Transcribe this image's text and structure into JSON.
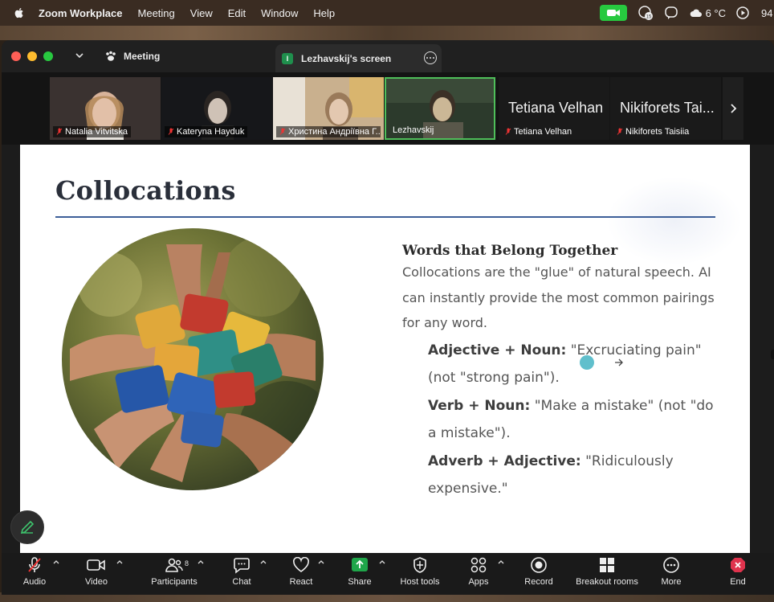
{
  "menubar": {
    "app": "Zoom Workplace",
    "items": [
      "Meeting",
      "View",
      "Edit",
      "Window",
      "Help"
    ],
    "badge_count": "15",
    "weather": "6 °C",
    "battery": "94"
  },
  "window": {
    "meeting_tab": "Meeting",
    "screen_tab": "Lezhavskij's screen",
    "screen_tab_badge": "l"
  },
  "participants": [
    {
      "name": "Natalia Vitvitska",
      "muted": true
    },
    {
      "name": "Kateryna Hayduk",
      "muted": true
    },
    {
      "name": "Христина Андріївна Г...",
      "muted": true
    },
    {
      "name": "Lezhavskij",
      "muted": false,
      "active": true
    },
    {
      "name": "Tetiana Velhan",
      "display": "Tetiana Velhan",
      "muted": true
    },
    {
      "name": "Nikiforets Taisiia",
      "display": "Nikiforets Tai...",
      "muted": true
    }
  ],
  "slide": {
    "title": "Collocations",
    "subtitle": "Words that Belong Together",
    "paragraph": "Collocations are the \"glue\" of natural speech. AI can instantly provide the most common pairings for any word.",
    "bullets": [
      {
        "label": "Adjective + Noun:",
        "text": " \"Excruciating pain\" (not \"strong pain\")."
      },
      {
        "label": "Verb + Noun:",
        "text": " \"Make a mistake\" (not \"do a mistake\")."
      },
      {
        "label": "Adverb + Adjective:",
        "text": " \"Ridiculously expensive.\""
      }
    ]
  },
  "toolbar": {
    "audio": "Audio",
    "video": "Video",
    "participants": "Participants",
    "participants_count": "8",
    "chat": "Chat",
    "react": "React",
    "share": "Share",
    "host_tools": "Host tools",
    "apps": "Apps",
    "record": "Record",
    "breakout": "Breakout rooms",
    "more": "More",
    "end": "End"
  },
  "colors": {
    "accent_green": "#27c93f",
    "share_green": "#1fa64a",
    "end_red": "#e0334d",
    "rule_blue": "#3d5f99"
  }
}
